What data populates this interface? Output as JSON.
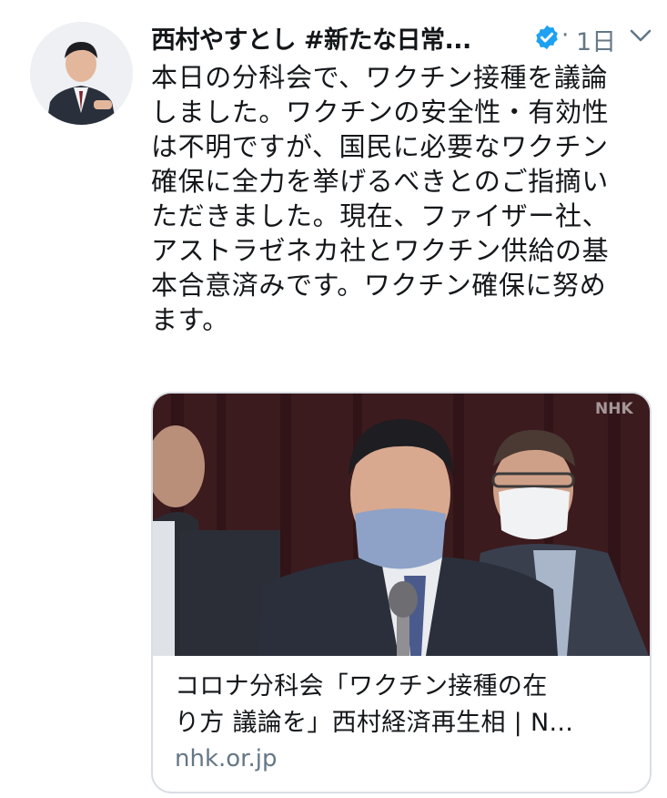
{
  "tweet": {
    "author_name": "西村やすとし #新たな日常...",
    "timestamp": "1日",
    "separator": "·",
    "lines": [
      "本日の分科会で、ワクチン接種を議論",
      "しました。ワクチンの安全性・有効性",
      "は不明ですが、国民に必要なワクチン",
      "確保に全力を挙げるべきとのご指摘い",
      "ただきました。現在、ファイザー社、",
      "アストラゼネカ社とワクチン供給の基",
      "本合意済みです。ワクチン確保に努め",
      "ます。"
    ]
  },
  "card": {
    "watermark": "NHK",
    "title_line1": "コロナ分科会「ワクチン接種の在",
    "title_line2": "り方 議論を」西村経済再生相 | N...",
    "domain": "nhk.or.jp"
  },
  "colors": {
    "verified": "#1da1f2",
    "muted": "#657786",
    "border": "#d9dee3"
  }
}
